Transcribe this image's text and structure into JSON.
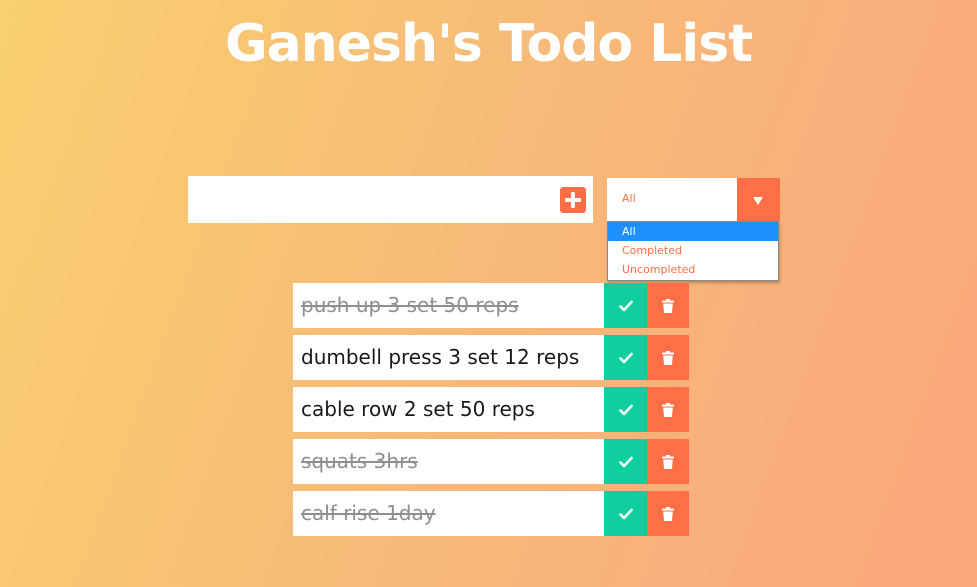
{
  "header": {
    "title": "Ganesh's Todo List"
  },
  "form": {
    "input_value": "",
    "input_placeholder": ""
  },
  "filter": {
    "selected": "All",
    "options": [
      "All",
      "Completed",
      "Uncompleted"
    ]
  },
  "todos": [
    {
      "text": "push up 3 set 50 reps",
      "completed": true
    },
    {
      "text": "dumbell press 3 set 12 reps",
      "completed": false
    },
    {
      "text": "cable row 2 set 50 reps",
      "completed": false
    },
    {
      "text": "squats 3hrs",
      "completed": true
    },
    {
      "text": "calf rise 1day",
      "completed": true
    }
  ],
  "colors": {
    "accent": "#ff6f47",
    "check": "#0fcf9f",
    "selected_option": "#1e90ff"
  },
  "icons": {
    "add": "plus-square-icon",
    "dropdown": "caret-down-icon",
    "complete": "check-icon",
    "delete": "trash-icon"
  }
}
